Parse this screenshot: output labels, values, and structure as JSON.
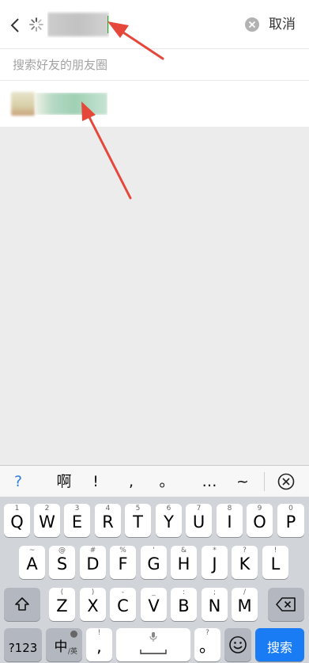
{
  "header": {
    "search_query": "",
    "cancel_label": "取消"
  },
  "results": {
    "moments_hint": "搜索好友的朋友圈",
    "items": [
      {
        "name": ""
      }
    ]
  },
  "candidates": [
    "?",
    "啊",
    "!",
    ",",
    "。",
    "…",
    "~"
  ],
  "keyboard": {
    "row1": [
      {
        "main": "Q",
        "sub": "1"
      },
      {
        "main": "W",
        "sub": "2"
      },
      {
        "main": "E",
        "sub": "3"
      },
      {
        "main": "R",
        "sub": "4"
      },
      {
        "main": "T",
        "sub": "5"
      },
      {
        "main": "Y",
        "sub": "6"
      },
      {
        "main": "U",
        "sub": "7"
      },
      {
        "main": "I",
        "sub": "8"
      },
      {
        "main": "O",
        "sub": "9"
      },
      {
        "main": "P",
        "sub": "0"
      }
    ],
    "row2": [
      {
        "main": "A",
        "sub": "~"
      },
      {
        "main": "S",
        "sub": "@"
      },
      {
        "main": "D",
        "sub": "#"
      },
      {
        "main": "F",
        "sub": "%"
      },
      {
        "main": "G",
        "sub": "'"
      },
      {
        "main": "H",
        "sub": "&"
      },
      {
        "main": "J",
        "sub": "*"
      },
      {
        "main": "K",
        "sub": "?"
      },
      {
        "main": "L",
        "sub": "!"
      }
    ],
    "row3": [
      {
        "main": "Z",
        "sub": "("
      },
      {
        "main": "X",
        "sub": ")"
      },
      {
        "main": "C",
        "sub": "-"
      },
      {
        "main": "V",
        "sub": "_"
      },
      {
        "main": "B",
        "sub": ":"
      },
      {
        "main": "N",
        "sub": ";"
      },
      {
        "main": "M",
        "sub": "/"
      }
    ],
    "num_key": "?123",
    "lang_key": "中",
    "lang_key_alt": "/英",
    "comma_key": ",",
    "comma_sub": "!",
    "period_key": "。",
    "period_sub": "?",
    "search_key": "搜索"
  },
  "colors": {
    "accent": "#1a7cf5",
    "link": "#576b95",
    "arrow": "#e5483b"
  }
}
